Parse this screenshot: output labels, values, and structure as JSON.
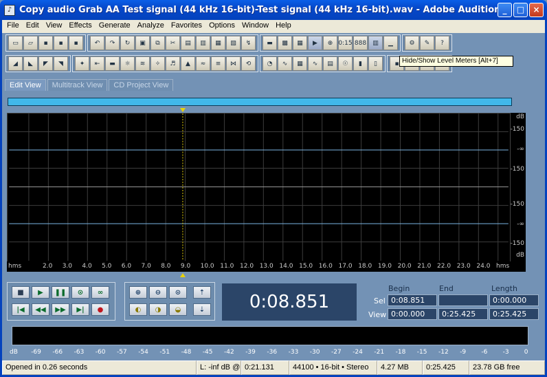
{
  "window": {
    "title": "Copy audio Grab AA Test signal (44 kHz 16-bit)-Test signal (44 kHz 16-bit).wav - Adobe Audition",
    "controls": [
      "_",
      "□",
      "×"
    ]
  },
  "menu": [
    "File",
    "Edit",
    "View",
    "Effects",
    "Generate",
    "Analyze",
    "Favorites",
    "Options",
    "Window",
    "Help"
  ],
  "toolbar": {
    "tooltip": "Hide/Show Level Meters   [Alt+7]"
  },
  "tabs": [
    "Edit View",
    "Multitrack View",
    "CD Project View"
  ],
  "waveform": {
    "db_labels_top": [
      "dB",
      "-150",
      "-∞",
      "-150"
    ],
    "db_labels_bottom": [
      "-150",
      "-∞",
      "-150",
      "dB"
    ],
    "time_unit": "hms",
    "time_ticks": [
      "2.0",
      "3.0",
      "4.0",
      "5.0",
      "6.0",
      "7.0",
      "8.0",
      "9.0",
      "10.0",
      "11.0",
      "12.0",
      "13.0",
      "14.0",
      "15.0",
      "16.0",
      "17.0",
      "18.0",
      "19.0",
      "20.0",
      "21.0",
      "22.0",
      "23.0",
      "24.0"
    ],
    "time_unit_right": "hms",
    "colors": {
      "background": "#000000",
      "grid": "#3d3d3d",
      "center_line": "#7bb6e4",
      "overview": "#41b8ea"
    }
  },
  "transport": {
    "time_display": "0:08.851"
  },
  "selection": {
    "headers": {
      "begin": "Begin",
      "end": "End",
      "length": "Length"
    },
    "sel_label": "Sel",
    "view_label": "View",
    "sel": {
      "begin": "0:08.851",
      "end": "",
      "length": "0:00.000"
    },
    "view": {
      "begin": "0:00.000",
      "end": "0:25.425",
      "length": "0:25.425"
    }
  },
  "level_meter": {
    "scale": [
      "dB",
      "-69",
      "-66",
      "-63",
      "-60",
      "-57",
      "-54",
      "-51",
      "-48",
      "-45",
      "-42",
      "-39",
      "-36",
      "-33",
      "-30",
      "-27",
      "-24",
      "-21",
      "-18",
      "-15",
      "-12",
      "-9",
      "-6",
      "-3",
      "0"
    ]
  },
  "status": {
    "message": "Opened in 0.26 seconds",
    "level": "L: -inf dB @",
    "level_time": "0:21.131",
    "format": "44100 • 16-bit • Stereo",
    "size": "4.27 MB",
    "duration": "0:25.425",
    "free": "23.78 GB free"
  }
}
